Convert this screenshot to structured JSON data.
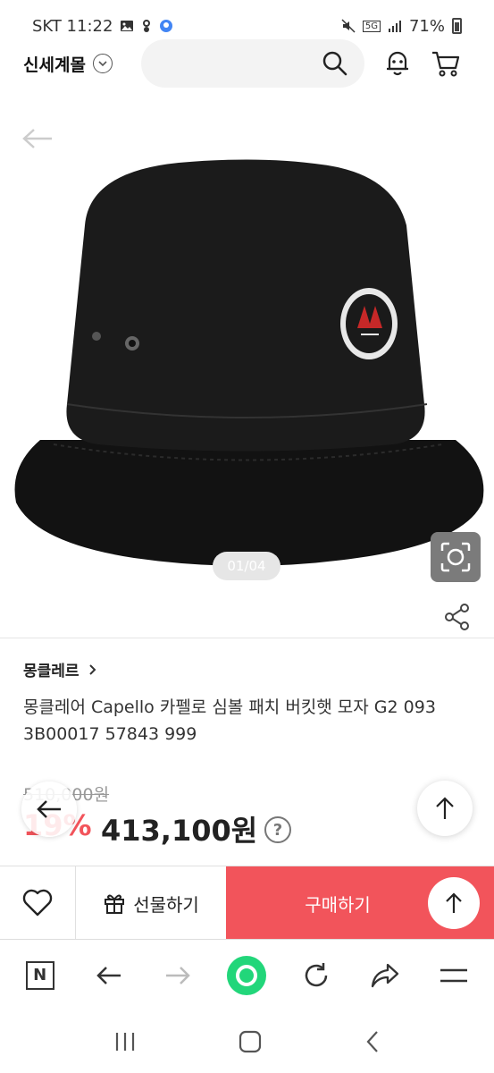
{
  "status_bar": {
    "carrier_time": "SKT 11:22",
    "battery": "71%",
    "network": "5G"
  },
  "header": {
    "brand": "신세계몰",
    "search_placeholder": ""
  },
  "gallery": {
    "pager": "01/04"
  },
  "product": {
    "brand": "몽클레르",
    "title": "몽클레어 Capello 카펠로 심볼 패치 버킷햇 모자 G2 093 3B00017 57843 999",
    "original_price": "510,000원",
    "discount": "19%",
    "price": "413,100원"
  },
  "actions": {
    "gift_label": "선물하기",
    "buy_label": "구매하기"
  },
  "colors": {
    "accent": "#f2545b",
    "home_green": "#22d67a"
  }
}
